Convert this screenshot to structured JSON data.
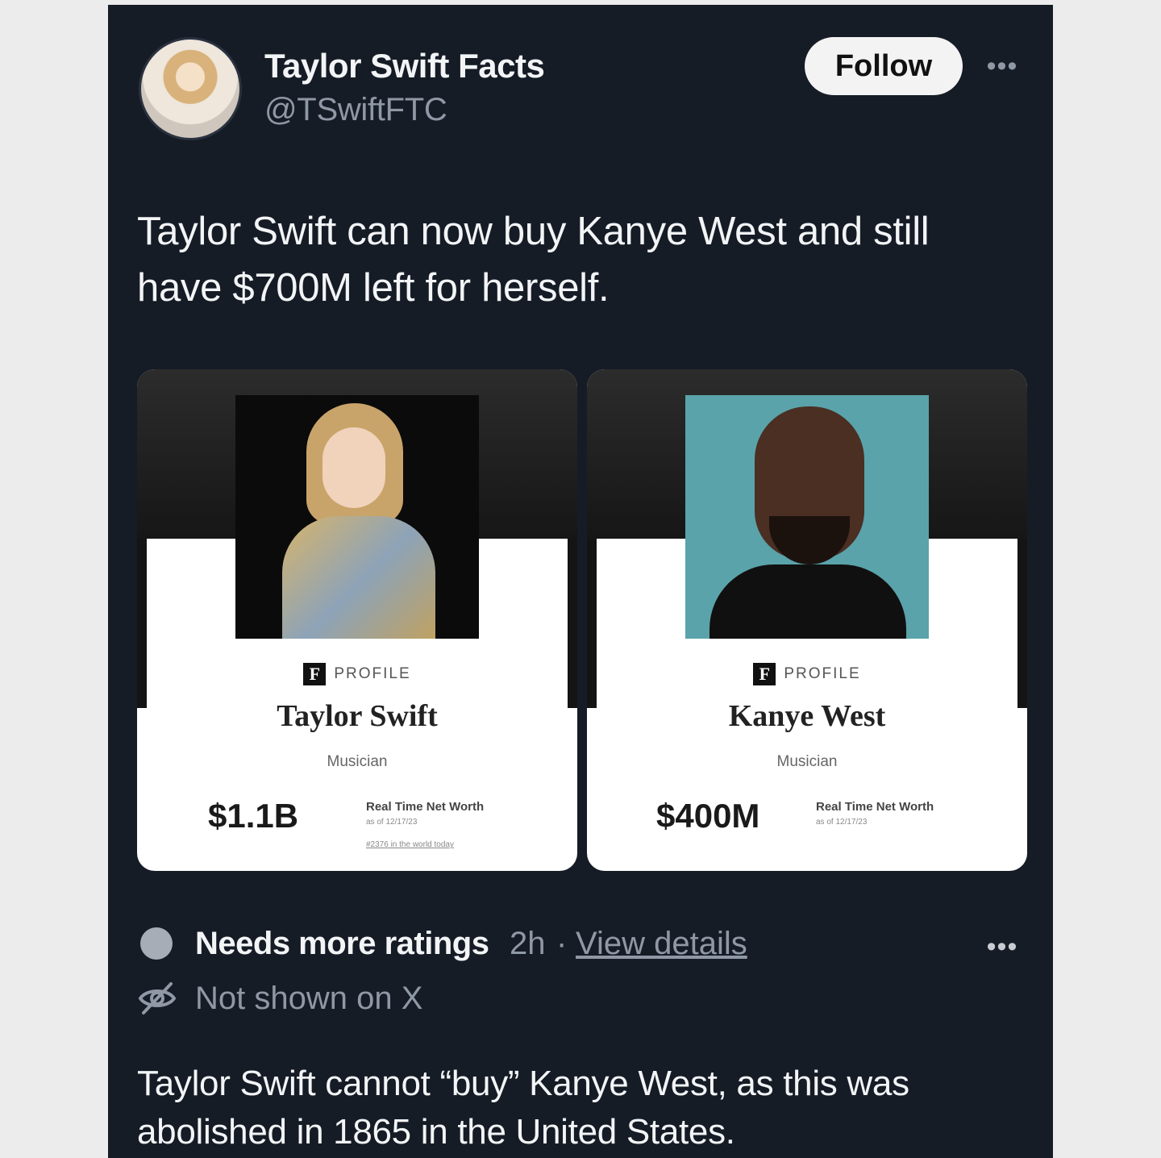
{
  "author": {
    "name": "Taylor Swift Facts",
    "handle": "@TSwiftFTC",
    "follow_label": "Follow",
    "more_icon": "more-horizontal-icon"
  },
  "tweet": {
    "text": "Taylor Swift can now buy Kanye West and still have $700M left for herself."
  },
  "cards": [
    {
      "profile_label": "PROFILE",
      "logo_letter": "F",
      "name": "Taylor Swift",
      "occupation": "Musician",
      "net_worth": "$1.1B",
      "net_worth_label": "Real Time Net Worth",
      "as_of": "as of 12/17/23",
      "rank": "#2376 in the world today"
    },
    {
      "profile_label": "PROFILE",
      "logo_letter": "F",
      "name": "Kanye West",
      "occupation": "Musician",
      "net_worth": "$400M",
      "net_worth_label": "Real Time Net Worth",
      "as_of": "as of 12/17/23"
    }
  ],
  "community_note": {
    "status": "Needs more ratings",
    "time": "2h",
    "separator": "·",
    "link": "View details",
    "visibility": "Not shown on X",
    "text": "Taylor Swift cannot “buy” Kanye West, as this was abolished in 1865 in the United States.",
    "status_color": "#a7adb6"
  },
  "colors": {
    "background": "#161c26",
    "text": "#f2f4f6",
    "muted": "#8f98a5"
  }
}
